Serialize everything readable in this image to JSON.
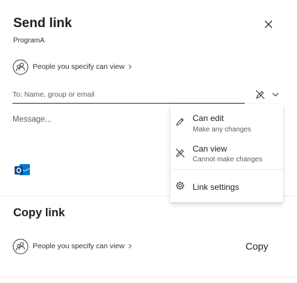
{
  "dialog": {
    "title": "Send link",
    "subtitle": "ProgramA",
    "close_icon": "close-icon"
  },
  "send": {
    "permission_label": "People you specify can view",
    "to_placeholder": "To: Name, group or email",
    "message_placeholder": "Message...",
    "permission_toggle_icon": "no-edit-pencil-icon"
  },
  "copy": {
    "title": "Copy link",
    "permission_label": "People you specify can view",
    "button_label": "Copy"
  },
  "menu": {
    "items": [
      {
        "label": "Can edit",
        "description": "Make any changes",
        "icon": "pencil-icon"
      },
      {
        "label": "Can view",
        "description": "Cannot make changes",
        "icon": "no-edit-pencil-icon"
      },
      {
        "label": "Link settings",
        "icon": "gear-icon"
      }
    ]
  },
  "colors": {
    "outlook_blue": "#0078d4",
    "outlook_dark": "#0f4a8a",
    "text_primary": "#201f1e",
    "text_secondary": "#605e5c"
  }
}
